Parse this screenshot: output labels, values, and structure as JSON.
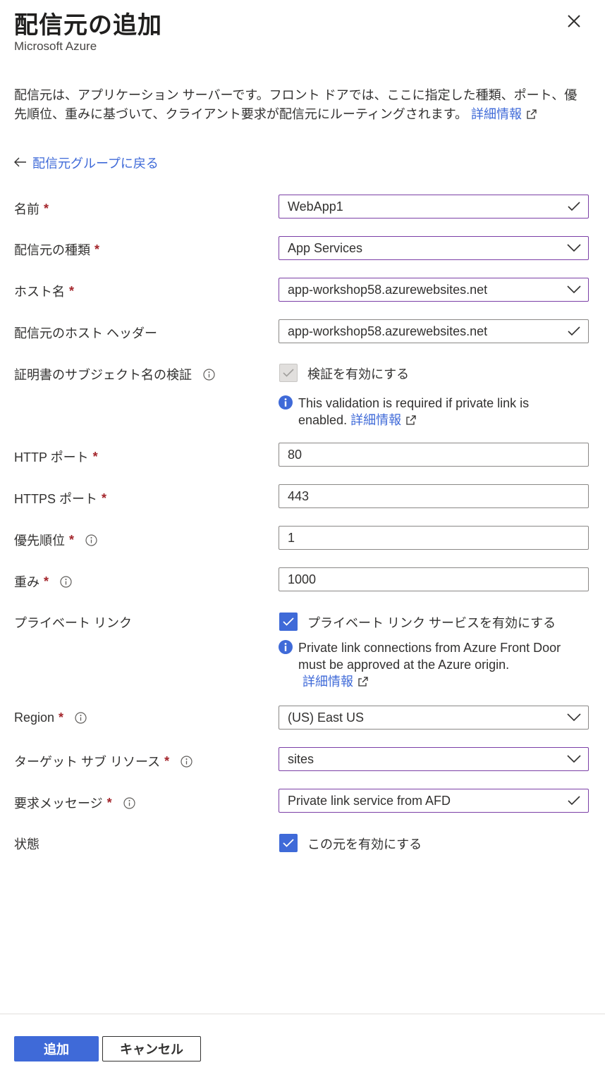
{
  "panel": {
    "title": "配信元の追加",
    "subtitle": "Microsoft Azure",
    "description": "配信元は、アプリケーション サーバーです。フロント ドアでは、ここに指定した種類、ポート、優先順位、重みに基づいて、クライアント要求が配信元にルーティングされます。",
    "learn_more": "詳細情報",
    "back_link": "配信元グループに戻る"
  },
  "form": {
    "name": {
      "label": "名前",
      "value": "WebApp1"
    },
    "origin_type": {
      "label": "配信元の種類",
      "value": "App Services"
    },
    "host_name": {
      "label": "ホスト名",
      "value": "app-workshop58.azurewebsites.net"
    },
    "host_header": {
      "label": "配信元のホスト ヘッダー",
      "value": "app-workshop58.azurewebsites.net"
    },
    "cert_validation": {
      "label": "証明書のサブジェクト名の検証",
      "checkbox_label": "検証を有効にする",
      "note_line1": "This validation is required if private link is",
      "note_line2": "enabled.",
      "learn_more": "詳細情報"
    },
    "http_port": {
      "label": "HTTP ポート",
      "value": "80"
    },
    "https_port": {
      "label": "HTTPS ポート",
      "value": "443"
    },
    "priority": {
      "label": "優先順位",
      "value": "1"
    },
    "weight": {
      "label": "重み",
      "value": "1000"
    },
    "private_link": {
      "label": "プライベート リンク",
      "checkbox_label": "プライベート リンク サービスを有効にする",
      "note_line1": "Private link connections from Azure Front Door",
      "note_line2": "must be approved at the Azure origin.",
      "learn_more": "詳細情報"
    },
    "region": {
      "label": "Region",
      "value": "(US) East US"
    },
    "target_sub_resource": {
      "label": "ターゲット サブ リソース",
      "value": "sites"
    },
    "request_message": {
      "label": "要求メッセージ",
      "value": "Private link service from AFD"
    },
    "status": {
      "label": "状態",
      "checkbox_label": "この元を有効にする"
    },
    "required_mark": "*"
  },
  "footer": {
    "add_button": "追加",
    "cancel_button": "キャンセル"
  },
  "colors": {
    "accent": "#3f6ad8",
    "required": "#a4262c",
    "field_focus": "#7b3fa6"
  }
}
